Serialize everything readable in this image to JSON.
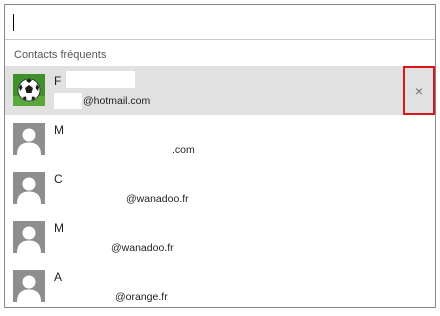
{
  "search": {
    "value": "",
    "placeholder": ""
  },
  "section_title": "Contacts fréquents",
  "contacts": [
    {
      "name": "F",
      "email": "@hotmail.com",
      "avatar": "soccer-ball-avatar",
      "selected": true
    },
    {
      "name": "M",
      "email": ".com",
      "avatar": "default-person-avatar",
      "selected": false
    },
    {
      "name": "C",
      "email": "@wanadoo.fr",
      "avatar": "default-person-avatar",
      "selected": false
    },
    {
      "name": "M",
      "email": "@wanadoo.fr",
      "avatar": "default-person-avatar",
      "selected": false
    },
    {
      "name": "A",
      "email": "@orange.fr",
      "avatar": "default-person-avatar",
      "selected": false
    }
  ],
  "remove_label": "×",
  "colors": {
    "selected_bg": "#e1e1e1",
    "highlight_border": "#d9171b",
    "avatar_grey": "#8e8e8e"
  }
}
